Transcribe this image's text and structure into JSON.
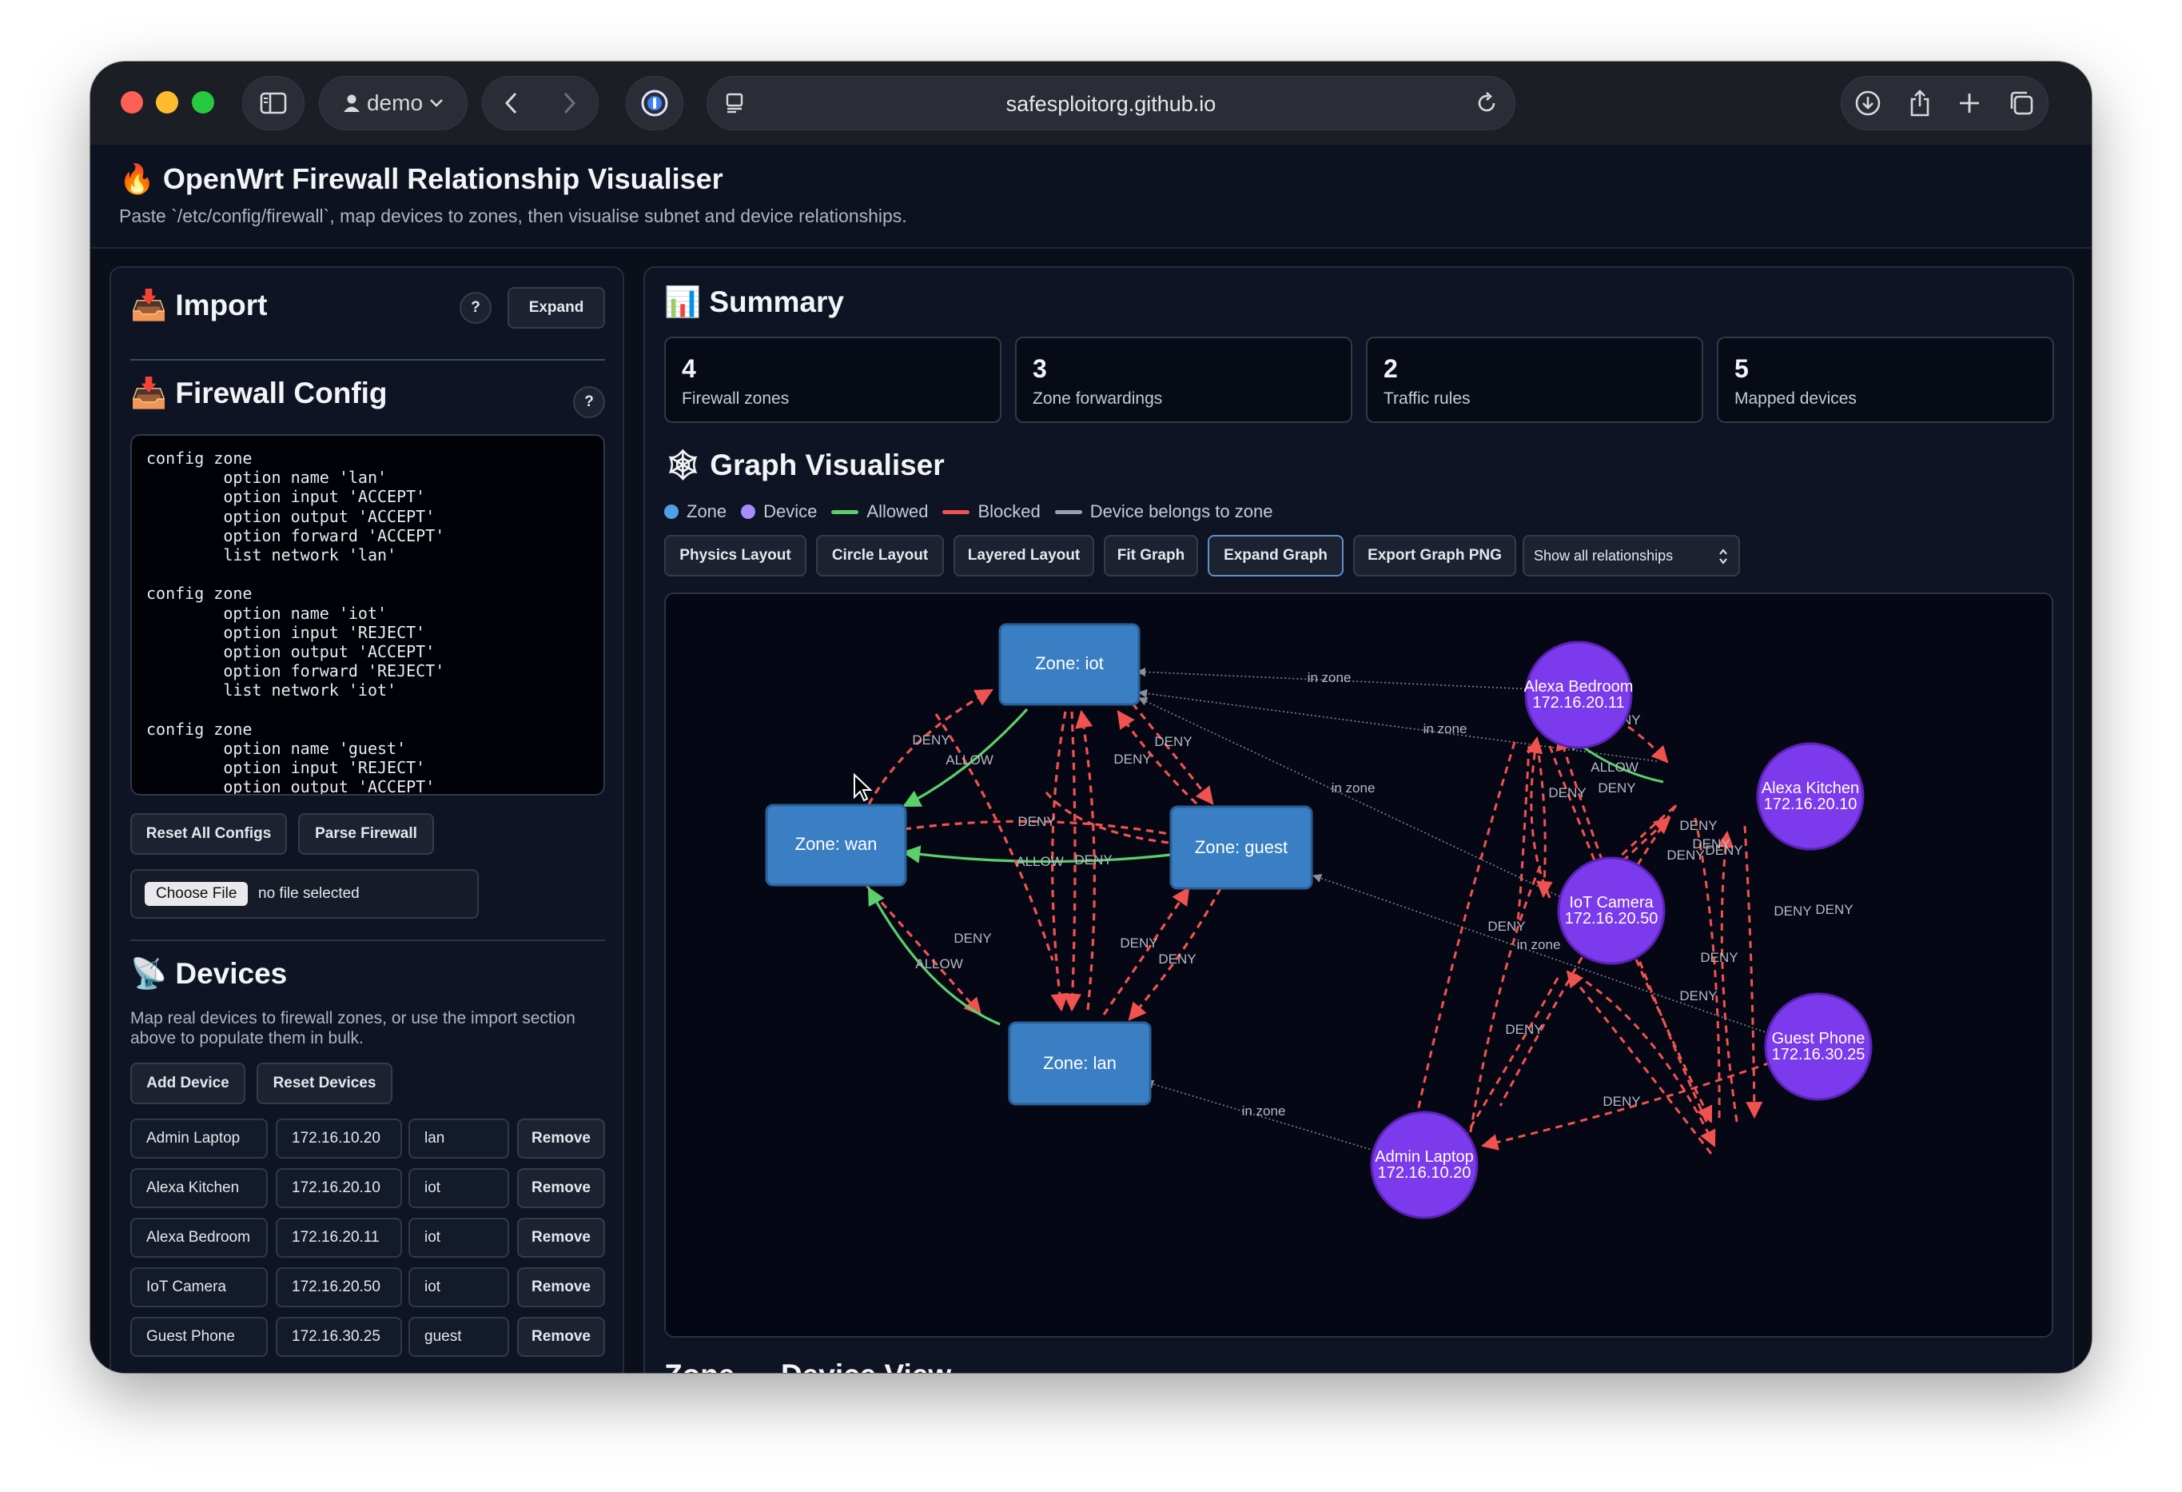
{
  "browser": {
    "profile": "demo",
    "url": "safesploitorg.github.io"
  },
  "app": {
    "icon": "fire-icon",
    "title": "🔥 OpenWrt Firewall Relationship Visualiser",
    "subtitle": "Paste `/etc/config/firewall`, map devices to zones, then visualise subnet and device relationships."
  },
  "import": {
    "title": "📥 Import",
    "help": "?",
    "expand": "Expand"
  },
  "firewall_config": {
    "title": "📥 Firewall Config",
    "help": "?",
    "text": "config zone\n        option name 'lan'\n        option input 'ACCEPT'\n        option output 'ACCEPT'\n        option forward 'ACCEPT'\n        list network 'lan'\n\nconfig zone\n        option name 'iot'\n        option input 'REJECT'\n        option output 'ACCEPT'\n        option forward 'REJECT'\n        list network 'iot'\n\nconfig zone\n        option name 'guest'\n        option input 'REJECT'\n        option output 'ACCEPT'",
    "reset_all": "Reset All Configs",
    "parse": "Parse Firewall",
    "choose_file": "Choose File",
    "no_file": "no file selected"
  },
  "devices": {
    "title": "📡 Devices",
    "description": "Map real devices to firewall zones, or use the import section above to populate them in bulk.",
    "add": "Add Device",
    "reset": "Reset Devices",
    "remove_label": "Remove",
    "rows": [
      {
        "name": "Admin Laptop",
        "ip": "172.16.10.20",
        "zone": "lan"
      },
      {
        "name": "Alexa Kitchen",
        "ip": "172.16.20.10",
        "zone": "iot"
      },
      {
        "name": "Alexa Bedroom",
        "ip": "172.16.20.11",
        "zone": "iot"
      },
      {
        "name": "IoT Camera",
        "ip": "172.16.20.50",
        "zone": "iot"
      },
      {
        "name": "Guest Phone",
        "ip": "172.16.30.25",
        "zone": "guest"
      }
    ]
  },
  "summary": {
    "title": "📊 Summary",
    "stats": [
      {
        "value": "4",
        "label": "Firewall zones"
      },
      {
        "value": "3",
        "label": "Zone forwardings"
      },
      {
        "value": "2",
        "label": "Traffic rules"
      },
      {
        "value": "5",
        "label": "Mapped devices"
      }
    ]
  },
  "graph": {
    "title": "🕸 Graph Visualiser",
    "legend": [
      {
        "label": "Zone",
        "kind": "dot",
        "color": "#4ea1e6"
      },
      {
        "label": "Device",
        "kind": "dot",
        "color": "#a78bfa"
      },
      {
        "label": "Allowed",
        "kind": "line",
        "color": "#5ccf6b"
      },
      {
        "label": "Blocked",
        "kind": "line",
        "color": "#f0524f"
      },
      {
        "label": "Device belongs to zone",
        "kind": "line",
        "color": "#9aa0aa"
      }
    ],
    "buttons": {
      "physics": "Physics Layout",
      "circle": "Circle Layout",
      "layered": "Layered Layout",
      "fit": "Fit Graph",
      "expand": "Expand Graph",
      "export": "Export Graph PNG"
    },
    "filter": "Show all relationships",
    "colors": {
      "zone": "#3a7fc4",
      "device": "#7c3aed",
      "allow": "#5ccf6b",
      "deny": "#f0524f",
      "membership": "#8a909b"
    },
    "nodes": {
      "iot": "Zone: iot",
      "wan": "Zone: wan",
      "guest": "Zone: guest",
      "lan": "Zone: lan",
      "alexa_bedroom": {
        "name": "Alexa Bedroom",
        "ip": "172.16.20.11"
      },
      "alexa_kitchen": {
        "name": "Alexa Kitchen",
        "ip": "172.16.20.10"
      },
      "iot_camera": {
        "name": "IoT Camera",
        "ip": "172.16.20.50"
      },
      "guest_phone": {
        "name": "Guest Phone",
        "ip": "172.16.30.25"
      },
      "admin_laptop": {
        "name": "Admin Laptop",
        "ip": "172.16.10.20"
      }
    },
    "edge_labels": {
      "deny": "DENY",
      "allow": "ALLOW",
      "in_zone": "in zone"
    }
  },
  "next_section": "Zone ↔ Device View"
}
